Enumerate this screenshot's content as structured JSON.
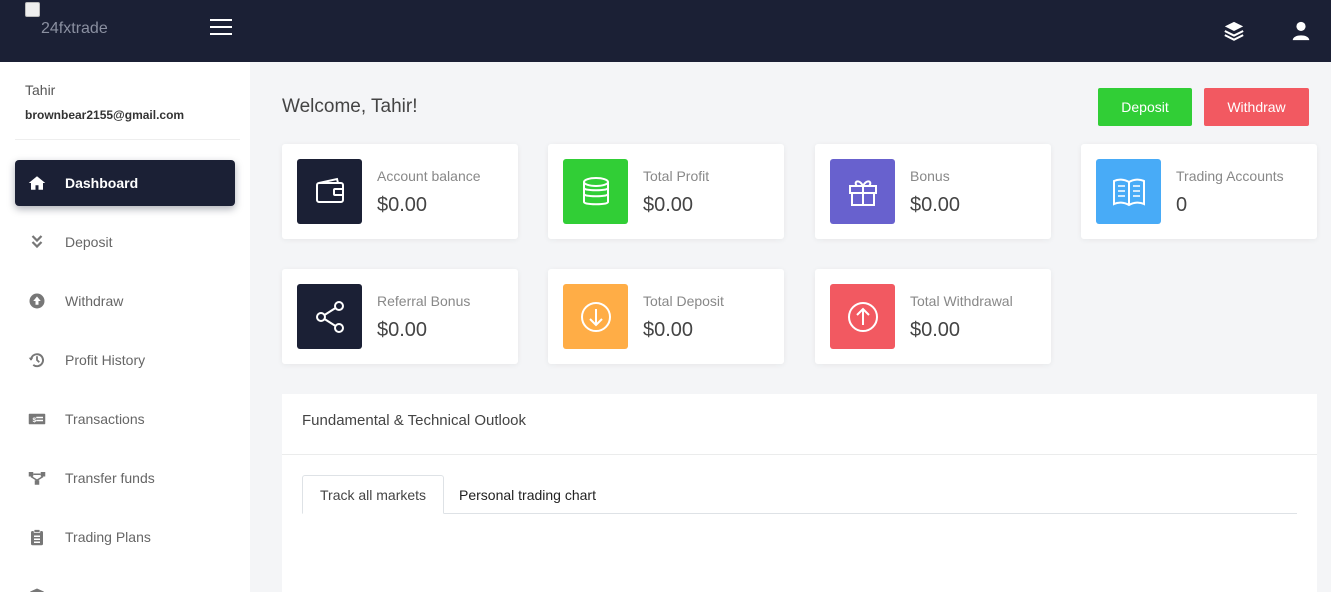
{
  "header": {
    "logo_alt": "24fxtrade",
    "menu_icon": "hamburger-icon",
    "right_icons": [
      "layers-icon",
      "user-icon"
    ]
  },
  "user": {
    "name": "Tahir",
    "email": "brownbear2155@gmail.com"
  },
  "sidebar": {
    "items": [
      {
        "label": "Dashboard",
        "icon": "home-icon",
        "active": true
      },
      {
        "label": "Deposit",
        "icon": "double-chevron-down-icon"
      },
      {
        "label": "Withdraw",
        "icon": "arrow-up-circle-icon"
      },
      {
        "label": "Profit History",
        "icon": "history-icon"
      },
      {
        "label": "Transactions",
        "icon": "money-bill-icon"
      },
      {
        "label": "Transfer funds",
        "icon": "network-icon"
      },
      {
        "label": "Trading Plans",
        "icon": "clipboard-icon"
      }
    ]
  },
  "main": {
    "welcome": "Welcome, Tahir!",
    "deposit_button": "Deposit",
    "withdraw_button": "Withdraw",
    "cards": [
      {
        "label": "Account balance",
        "value": "$0.00",
        "icon": "wallet-icon",
        "color": "#1b2035"
      },
      {
        "label": "Total Profit",
        "value": "$0.00",
        "icon": "coins-icon",
        "color": "#31ce36"
      },
      {
        "label": "Bonus",
        "value": "$0.00",
        "icon": "gift-icon",
        "color": "#6861ce"
      },
      {
        "label": "Trading Accounts",
        "value": "0",
        "icon": "book-icon",
        "color": "#48abf7"
      },
      {
        "label": "Referral Bonus",
        "value": "$0.00",
        "icon": "share-icon",
        "color": "#1b2035"
      },
      {
        "label": "Total Deposit",
        "value": "$0.00",
        "icon": "arrow-down-circle-icon",
        "color": "#ffad46"
      },
      {
        "label": "Total Withdrawal",
        "value": "$0.00",
        "icon": "arrow-up-circle-icon",
        "color": "#f25961"
      }
    ],
    "outlook": {
      "title": "Fundamental & Technical Outlook",
      "tabs": [
        "Track all markets",
        "Personal trading chart"
      ]
    }
  },
  "colors": {
    "navy": "#1b2035",
    "green": "#31ce36",
    "red": "#f25961",
    "purple": "#6861ce",
    "blue": "#48abf7",
    "orange": "#ffad46"
  }
}
